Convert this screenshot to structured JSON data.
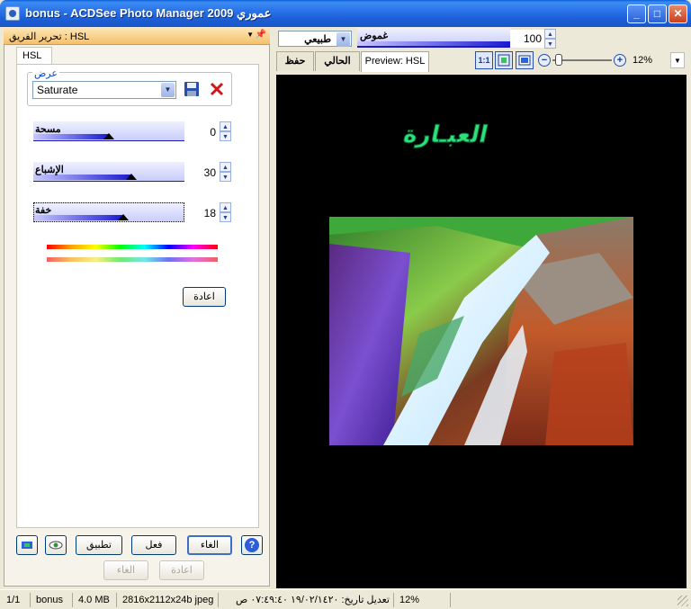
{
  "window": {
    "title": "bonus - ACDSee Photo Manager 2009 عموري",
    "buttons": {
      "minimize": "_",
      "maximize": "□",
      "close": "✕"
    }
  },
  "left_panel": {
    "header_title": "تحرير الفريق : HSL",
    "tab_label": "HSL",
    "preset_group_label": "عرض",
    "preset_value": "Saturate",
    "sliders": [
      {
        "label": "مسحة",
        "value": "0",
        "fraction": 0.5
      },
      {
        "label": "الإشباع",
        "value": "30",
        "fraction": 0.65
      },
      {
        "label": "خفة",
        "value": "18",
        "fraction": 0.59
      }
    ],
    "reset_label": "اعادة",
    "buttons": {
      "apply": "تطبيق",
      "done": "فعل",
      "cancel": "الغاء",
      "help": "?",
      "undo": "الغاء",
      "redo": "اعادة"
    }
  },
  "right_panel": {
    "mode_select": "طبيعي",
    "blur_label": "غموض",
    "blur_value": "100",
    "tabs": [
      "حفظ",
      "الحالي",
      "Preview: HSL"
    ],
    "zoom_value": "12%",
    "overlay_text": "العبـارة"
  },
  "status_bar": {
    "count": "1/1",
    "name": "bonus",
    "size": "4.0 MB",
    "dimensions": "2816x2112x24b jpeg",
    "modified": "تعديل تاريخ: ١٩/٠٢/١٤٢٠ ٠٧:٤٩:٤٠ ص",
    "zoom": "12%"
  },
  "colors": {
    "title_bar": "#1c5fd6",
    "panel_header": "#f3c06c",
    "slider_fill": "#1a1ad0",
    "overlay_text": "#2ee07a",
    "canvas": "#000000"
  }
}
